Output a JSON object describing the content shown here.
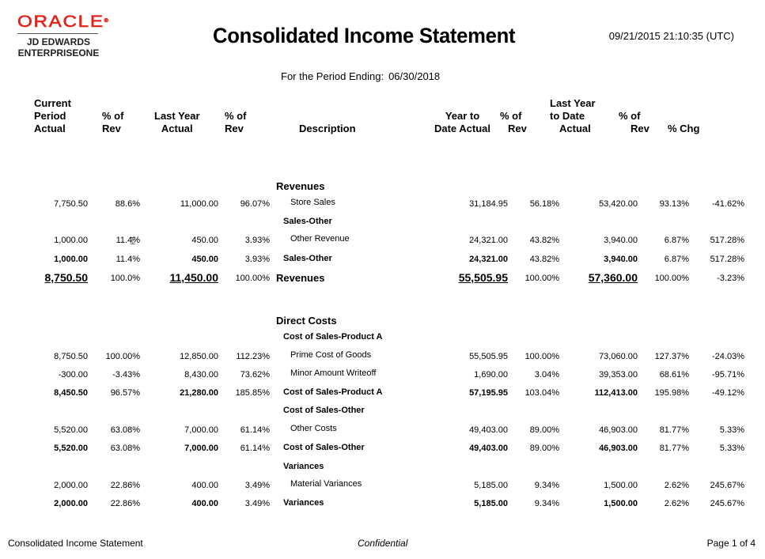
{
  "logo": {
    "brand": "ORACLE",
    "line1": "JD EDWARDS",
    "line2": "ENTERPRISEONE",
    "brand_color": "#e2231a"
  },
  "header": {
    "title": "Consolidated Income Statement",
    "timestamp": "09/21/2015 21:10:35 (UTC)",
    "period_label": "For the Period Ending:",
    "period_value": "06/30/2018"
  },
  "columns": {
    "cur_actual": [
      "Current",
      "Period",
      "Actual"
    ],
    "cur_pct": [
      "% of",
      "Rev"
    ],
    "ly_actual": [
      "Last Year",
      "Actual"
    ],
    "ly_pct": [
      "% of",
      "Rev"
    ],
    "desc": "Description",
    "ytd_actual": [
      "Year to",
      "Date Actual"
    ],
    "ytd_pct": [
      "% of",
      "Rev"
    ],
    "lytd_actual": [
      "Last Year",
      "to Date",
      "Actual"
    ],
    "lytd_pct": [
      "% of",
      "Rev"
    ],
    "chg": "% Chg"
  },
  "rows": [
    {
      "type": "section",
      "desc": "Revenues"
    },
    {
      "type": "detail",
      "desc": "Store Sales",
      "cur": "7,750.50",
      "curp": "88.6%",
      "ly": "11,000.00",
      "lyp": "96.07%",
      "ytd": "31,184.95",
      "ytdp": "56.18%",
      "lytd": "53,420.00",
      "lytdp": "93.13%",
      "chg": "-41.62%"
    },
    {
      "type": "subheader",
      "desc": "Sales-Other"
    },
    {
      "type": "detail",
      "desc": "Other Revenue",
      "cur": "1,000.00",
      "curp": "11.4%",
      "ly": "450.00",
      "lyp": "3.93%",
      "ytd": "24,321.00",
      "ytdp": "43.82%",
      "lytd": "3,940.00",
      "lytdp": "6.87%",
      "chg": "517.28%"
    },
    {
      "type": "subtotal",
      "desc": "Sales-Other",
      "cur": "1,000.00",
      "curp": "11.4%",
      "ly": "450.00",
      "lyp": "3.93%",
      "ytd": "24,321.00",
      "ytdp": "43.82%",
      "lytd": "3,940.00",
      "lytdp": "6.87%",
      "chg": "517.28%"
    },
    {
      "type": "total",
      "desc": "Revenues",
      "cur": "8,750.50",
      "curp": "100.0%",
      "ly": "11,450.00",
      "lyp": "100.00%",
      "ytd": "55,505.95",
      "ytdp": "100.00%",
      "lytd": "57,360.00",
      "lytdp": "100.00%",
      "chg": "-3.23%"
    },
    {
      "type": "section",
      "desc": "Direct Costs"
    },
    {
      "type": "subheader",
      "desc": "Cost of Sales-Product A"
    },
    {
      "type": "detail",
      "desc": "Prime Cost of Goods",
      "cur": "8,750.50",
      "curp": "100.00%",
      "ly": "12,850.00",
      "lyp": "112.23%",
      "ytd": "55,505.95",
      "ytdp": "100.00%",
      "lytd": "73,060.00",
      "lytdp": "127.37%",
      "chg": "-24.03%"
    },
    {
      "type": "detail",
      "desc": "Minor Amount Writeoff",
      "cur": "-300.00",
      "curp": "-3.43%",
      "ly": "8,430.00",
      "lyp": "73.62%",
      "ytd": "1,690.00",
      "ytdp": "3.04%",
      "lytd": "39,353.00",
      "lytdp": "68.61%",
      "chg": "-95.71%"
    },
    {
      "type": "subtotal",
      "desc": "Cost of Sales-Product A",
      "cur": "8,450.50",
      "curp": "96.57%",
      "ly": "21,280.00",
      "lyp": "185.85%",
      "ytd": "57,195.95",
      "ytdp": "103.04%",
      "lytd": "112,413.00",
      "lytdp": "195.98%",
      "chg": "-49.12%"
    },
    {
      "type": "subheader",
      "desc": "Cost of Sales-Other"
    },
    {
      "type": "detail",
      "desc": "Other Costs",
      "cur": "5,520.00",
      "curp": "63.08%",
      "ly": "7,000.00",
      "lyp": "61.14%",
      "ytd": "49,403.00",
      "ytdp": "89.00%",
      "lytd": "46,903.00",
      "lytdp": "81.77%",
      "chg": "5.33%"
    },
    {
      "type": "subtotal",
      "desc": "Cost of Sales-Other",
      "cur": "5,520.00",
      "curp": "63.08%",
      "ly": "7,000.00",
      "lyp": "61.14%",
      "ytd": "49,403.00",
      "ytdp": "89.00%",
      "lytd": "46,903.00",
      "lytdp": "81.77%",
      "chg": "5.33%"
    },
    {
      "type": "subheader",
      "desc": "Variances"
    },
    {
      "type": "detail",
      "desc": "Material Variances",
      "cur": "2,000.00",
      "curp": "22.86%",
      "ly": "400.00",
      "lyp": "3.49%",
      "ytd": "5,185.00",
      "ytdp": "9.34%",
      "lytd": "1,500.00",
      "lytdp": "2.62%",
      "chg": "245.67%"
    },
    {
      "type": "subtotal",
      "desc": "Variances",
      "cur": "2,000.00",
      "curp": "22.86%",
      "ly": "400.00",
      "lyp": "3.49%",
      "ytd": "5,185.00",
      "ytdp": "9.34%",
      "lytd": "1,500.00",
      "lytdp": "2.62%",
      "chg": "245.67%"
    }
  ],
  "footer": {
    "left": "Consolidated Income Statement",
    "center": "Confidential",
    "right": "Page 1 of 4"
  }
}
